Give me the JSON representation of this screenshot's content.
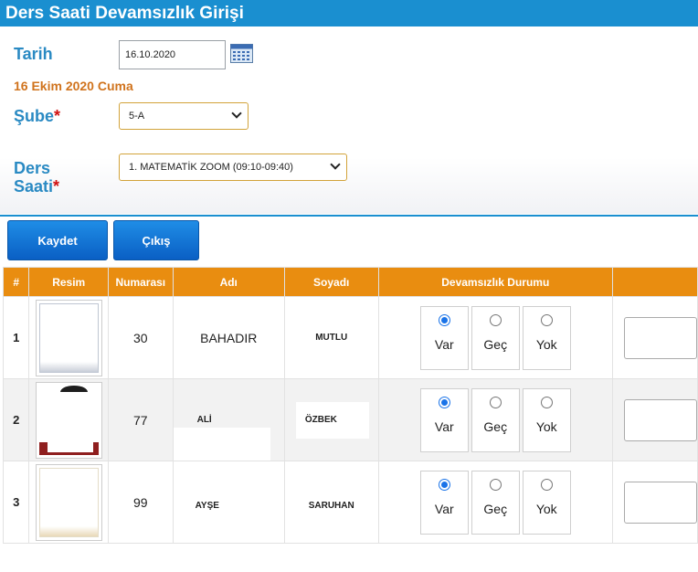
{
  "title": "Ders Saati Devamsızlık Girişi",
  "form": {
    "tarih_label": "Tarih",
    "date_value": "16.10.2020",
    "date_text": "16 Ekim 2020 Cuma",
    "sube_label": "Şube",
    "sube_value": "5-A",
    "ders_label_1": "Ders",
    "ders_label_2": "Saati",
    "ders_value": "1. MATEMATİK ZOOM (09:10-09:40)",
    "required_mark": "*"
  },
  "buttons": {
    "save": "Kaydet",
    "exit": "Çıkış"
  },
  "table": {
    "headers": [
      "#",
      "Resim",
      "Numarası",
      "Adı",
      "Soyadı",
      "Devamsızlık Durumu",
      ""
    ],
    "options": [
      "Var",
      "Geç",
      "Yok"
    ],
    "rows": [
      {
        "index": "1",
        "number": "30",
        "name": "BAHADIR",
        "surname": "MUTLU",
        "selected": "Var"
      },
      {
        "index": "2",
        "number": "77",
        "name": "ALİ",
        "surname": "ÖZBEK",
        "selected": "Var"
      },
      {
        "index": "3",
        "number": "99",
        "name": "AYŞE",
        "surname": "SARUHAN",
        "selected": "Var"
      }
    ]
  },
  "icons": {
    "calendar": "calendar-icon",
    "dropdown": "chevron-down-icon"
  }
}
